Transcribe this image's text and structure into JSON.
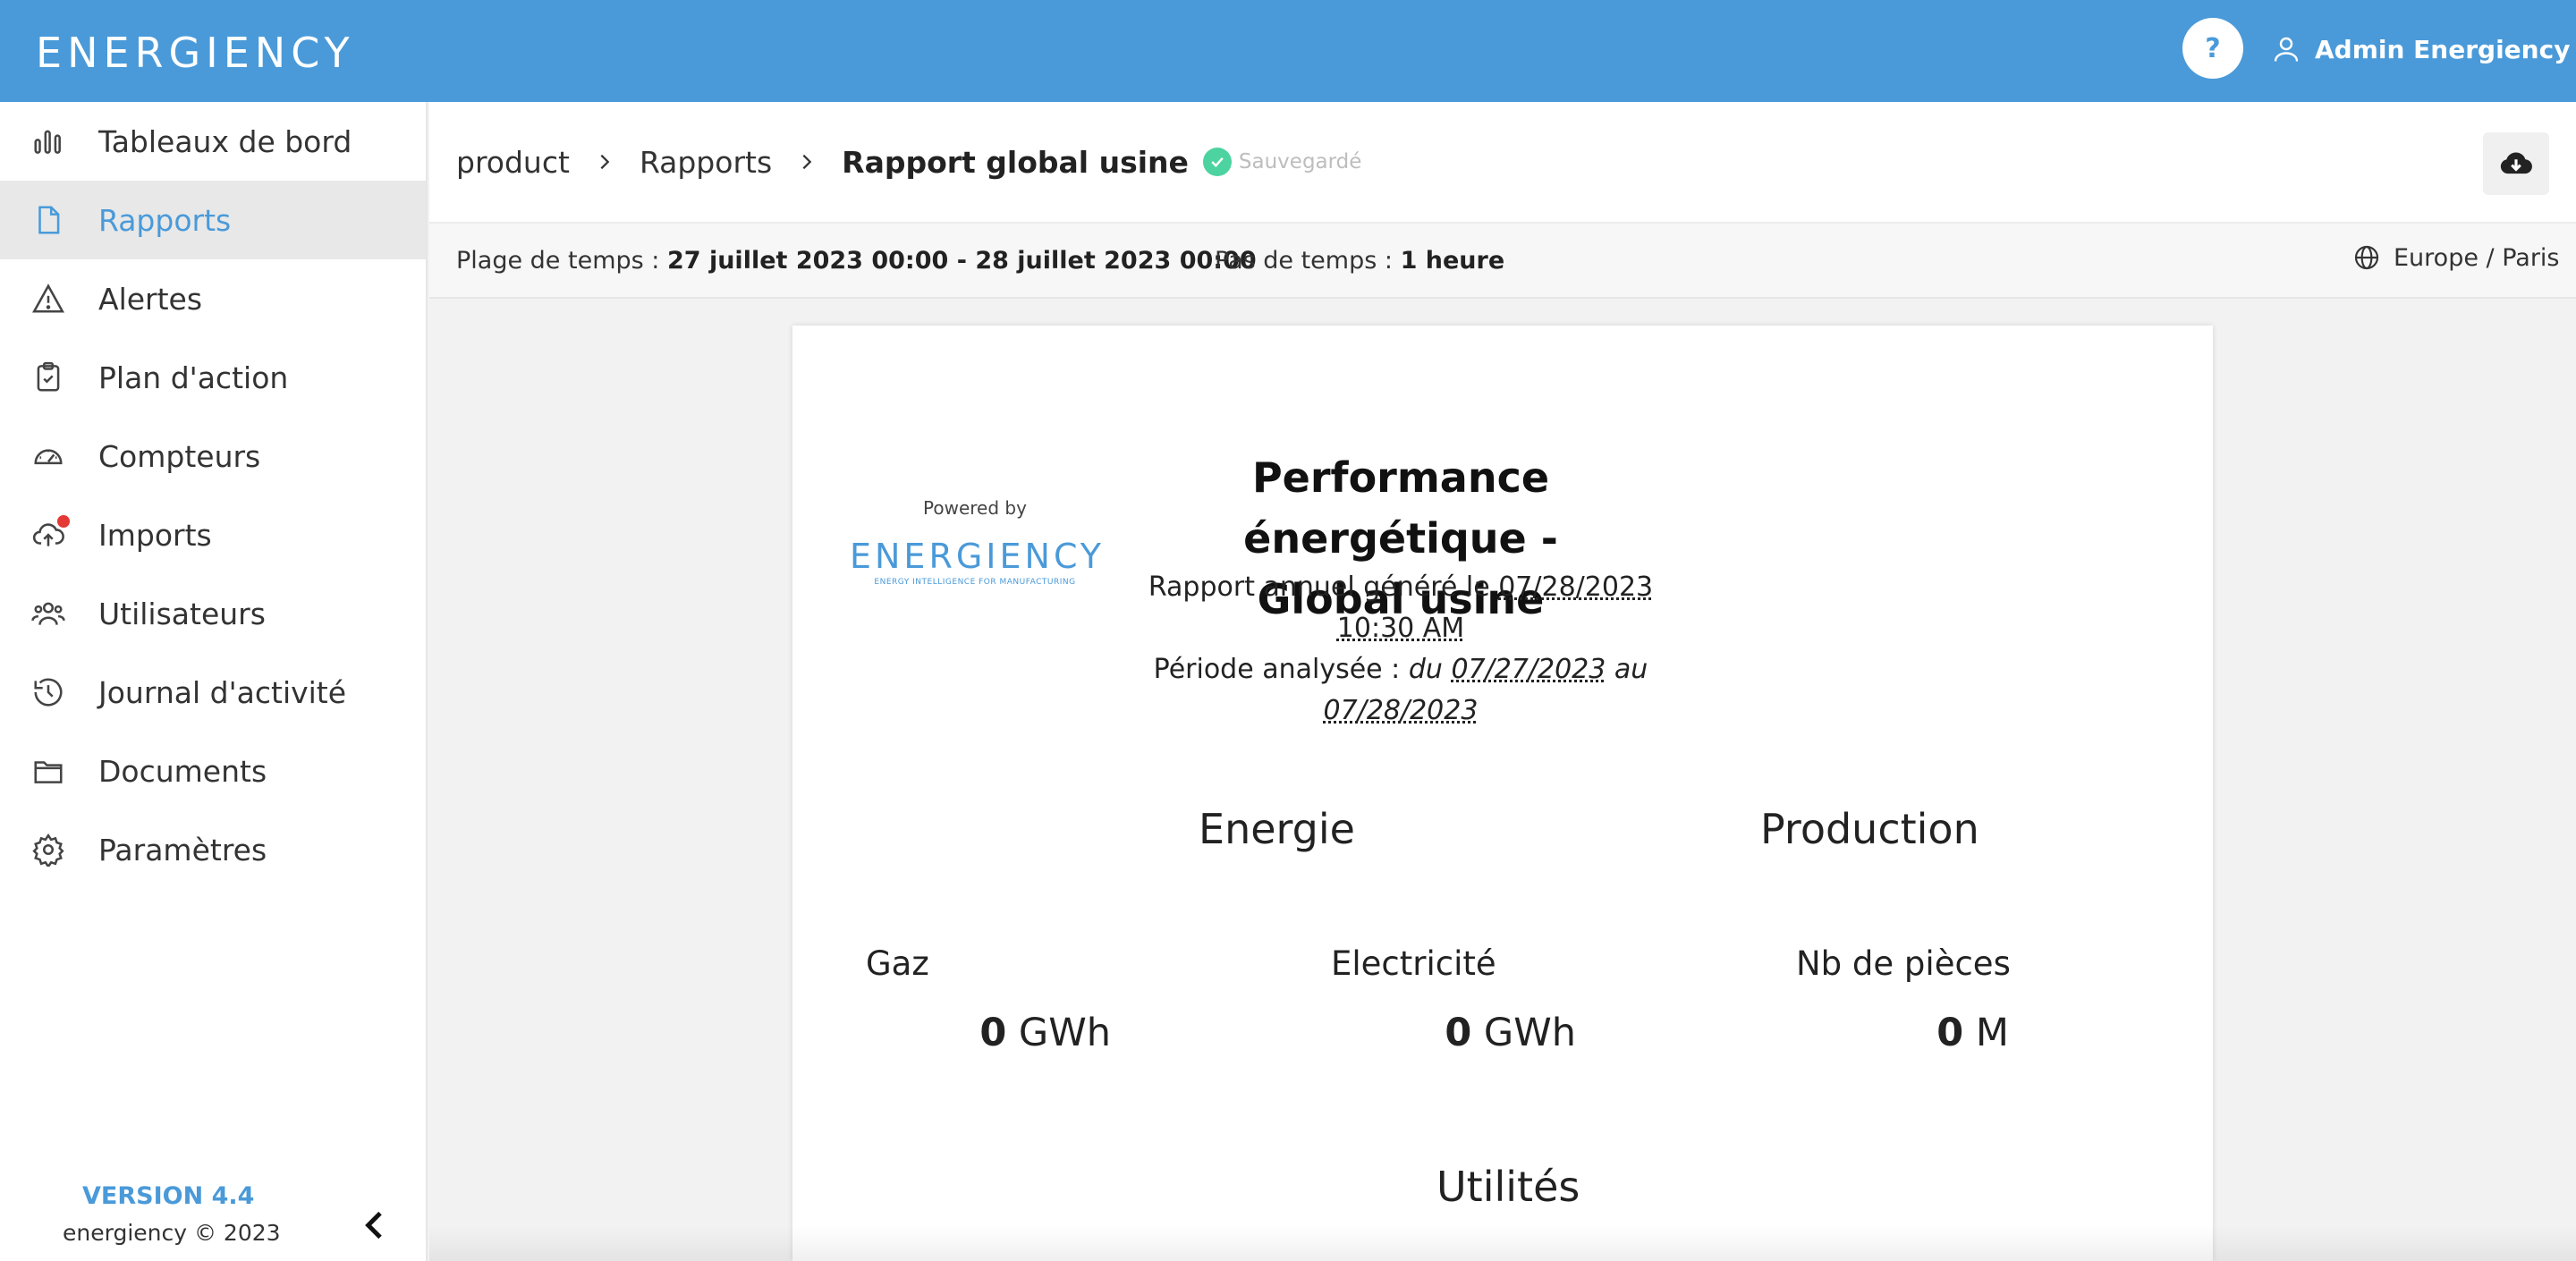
{
  "header": {
    "logo_text": "ENERGIENCY",
    "help_label": "?",
    "user_name": "Admin Energiency"
  },
  "sidebar": {
    "items": [
      {
        "label": "Tableaux de bord",
        "icon": "bar-chart-icon"
      },
      {
        "label": "Rapports",
        "icon": "document-icon",
        "active": true
      },
      {
        "label": "Alertes",
        "icon": "warning-icon"
      },
      {
        "label": "Plan d'action",
        "icon": "clipboard-check-icon"
      },
      {
        "label": "Compteurs",
        "icon": "gauge-icon"
      },
      {
        "label": "Imports",
        "icon": "cloud-upload-icon",
        "notification": true
      },
      {
        "label": "Utilisateurs",
        "icon": "users-icon"
      },
      {
        "label": "Journal d'activité",
        "icon": "history-icon"
      },
      {
        "label": "Documents",
        "icon": "folder-icon"
      },
      {
        "label": "Paramètres",
        "icon": "gear-icon"
      }
    ],
    "version": "VERSION 4.4",
    "copyright": "energiency © 2023"
  },
  "breadcrumb": {
    "items": [
      "product",
      "Rapports"
    ],
    "current": "Rapport global usine",
    "status": "Sauvegardé"
  },
  "timebar": {
    "range_label": "Plage de temps :",
    "range_value": "27 juillet 2023 00:00 - 28 juillet 2023 00:00",
    "step_label": "Pas de temps :",
    "step_value": "1 heure",
    "timezone": "Europe / Paris"
  },
  "report": {
    "powered_by": "Powered by",
    "logo_text": "ENERGIENCY",
    "logo_tagline": "ENERGY INTELLIGENCE FOR MANUFACTURING",
    "title_line1": "Performance énergétique -",
    "title_line2": "Global usine",
    "generated_prefix": "Rapport annuel généré le",
    "generated_date": "07/28/2023 10:30 AM",
    "period_prefix": "Période analysée :",
    "period_du": "du",
    "period_from": "07/27/2023",
    "period_au": "au",
    "period_to": "07/28/2023",
    "sections": {
      "energie": "Energie",
      "production": "Production",
      "utilites": "Utilités"
    },
    "metrics": [
      {
        "label": "Gaz",
        "value": "0",
        "unit": "GWh"
      },
      {
        "label": "Electricité",
        "value": "0",
        "unit": "GWh"
      },
      {
        "label": "Nb de pièces",
        "value": "0",
        "unit": "M"
      }
    ]
  },
  "colors": {
    "brand": "#4a9ad9",
    "saved": "#4cd3a0",
    "notification": "#e53935"
  }
}
